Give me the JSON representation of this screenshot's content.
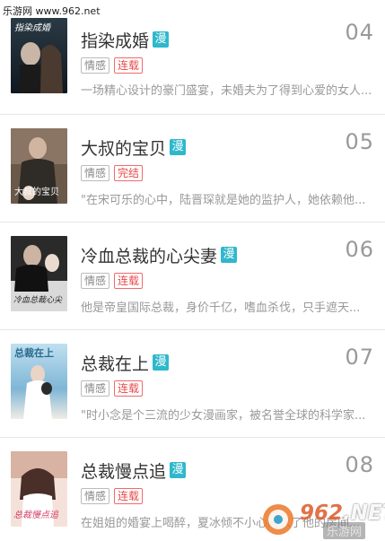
{
  "site": {
    "watermark": "乐游网 www.962.net"
  },
  "items": [
    {
      "title": "指染成婚",
      "badge": "漫",
      "rank": "04",
      "tags": [
        "情感",
        "连载"
      ],
      "desc": "一场精心设计的豪门盛宴，未婚夫为了得到心爱的女人...",
      "cover_text": "指染成婚",
      "cover_colors": [
        "#1e2a33",
        "#3b5263",
        "#c7d4dc"
      ]
    },
    {
      "title": "大叔的宝贝",
      "badge": "漫",
      "rank": "05",
      "tags": [
        "情感",
        "完结"
      ],
      "desc": "\"在宋可乐的心中，陆晋琛就是她的监护人，她依赖他...",
      "cover_text": "大叔的宝贝",
      "cover_colors": [
        "#2b2420",
        "#6e5a4c",
        "#d9c8b8"
      ]
    },
    {
      "title": "冷血总裁的心尖妻",
      "badge": "漫",
      "rank": "06",
      "tags": [
        "情感",
        "连载"
      ],
      "desc": "他是帝皇国际总裁，身价千亿，嗜血杀伐，只手遮天...",
      "cover_text": "冷血总裁心尖妻",
      "cover_colors": [
        "#141414",
        "#3a3a3a",
        "#e6e6e6"
      ]
    },
    {
      "title": "总裁在上",
      "badge": "漫",
      "rank": "07",
      "tags": [
        "情感",
        "连载"
      ],
      "desc": "\"时小念是个三流的少女漫画家，被名誉全球的科学家...",
      "cover_text": "总裁在上",
      "cover_colors": [
        "#6fa7c9",
        "#a8d1e6",
        "#f3f7fa"
      ]
    },
    {
      "title": "总裁慢点追",
      "badge": "漫",
      "rank": "08",
      "tags": [
        "情感",
        "连载"
      ],
      "desc": "在姐姐的婚宴上喝醉，夏冰倾不小心闯入了他的房间...",
      "cover_text": "总裁慢点追",
      "cover_colors": [
        "#c99b8a",
        "#e8c8bb",
        "#fbeee8"
      ]
    }
  ],
  "logo": {
    "brand": "962",
    "tld": ".NET",
    "sub": "乐游网"
  },
  "colors": {
    "badge": "#2fb8cc",
    "status_tag": "#e84a4a",
    "rank": "#999999"
  }
}
